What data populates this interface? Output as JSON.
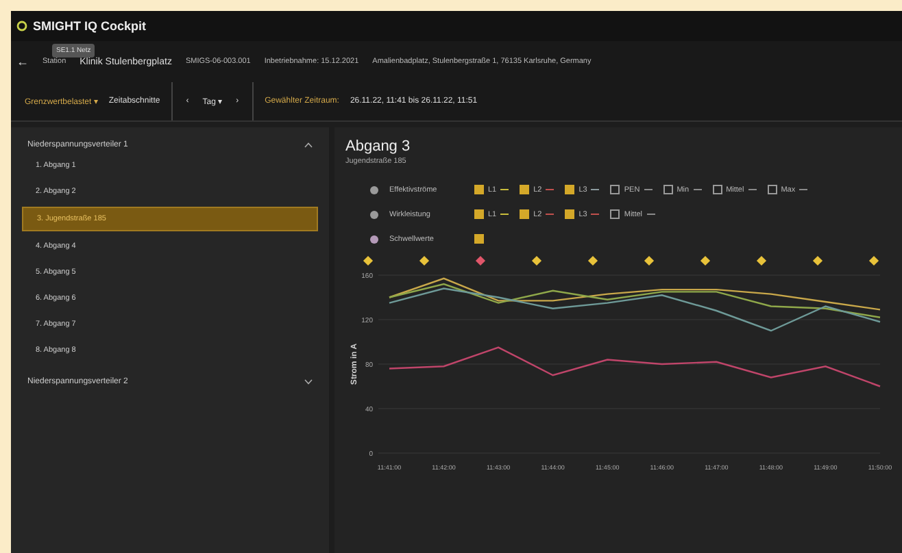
{
  "app": {
    "title": "SMIGHT IQ Cockpit"
  },
  "tooltip": "SE1.1 Netz",
  "info": {
    "back": "←",
    "label": "Station",
    "name": "Klinik Stulenbergplatz",
    "fields": [
      "SMIGS-06-003.001",
      "Inbetriebnahme: 15.12.2021",
      "Amalienbadplatz, Stulenbergstraße 1, 76135 Karlsruhe, Germany"
    ]
  },
  "toolbar": {
    "view": "Grenzwertbelastet",
    "view_caret": "▾",
    "mode": "Zeitabschnitte",
    "prev": "‹",
    "period": "Tag",
    "period_caret": "▾",
    "next": "›",
    "range_label": "Gewählter Zeitraum:",
    "range_value": "26.11.22, 11:41 bis 26.11.22, 11:51"
  },
  "sidebar": {
    "groups": [
      {
        "title": "Niederspannungsverteiler 1",
        "expanded": true,
        "items": [
          {
            "label": "1. Abgang 1",
            "selected": false
          },
          {
            "label": "2. Abgang 2",
            "selected": false
          },
          {
            "label": "3. Jugendstraße 185",
            "selected": true
          },
          {
            "label": "4. Abgang 4",
            "selected": false
          },
          {
            "label": "5. Abgang 5",
            "selected": false
          },
          {
            "label": "6. Abgang 6",
            "selected": false
          },
          {
            "label": "7. Abgang 7",
            "selected": false
          },
          {
            "label": "8. Abgang 8",
            "selected": false
          }
        ]
      },
      {
        "title": "Niederspannungsverteiler 2",
        "expanded": false
      }
    ]
  },
  "panel": {
    "title": "Abgang 3",
    "subtitle": "Jugendstraße 185",
    "filters": [
      {
        "label": "Effektivströme",
        "color": "#9a9a9a",
        "options": [
          {
            "label": "L1",
            "checked": true,
            "color": "#c9bd3c"
          },
          {
            "label": "L2",
            "checked": true,
            "color": "#c0504d"
          },
          {
            "label": "L3",
            "checked": true,
            "color": "#8c9a9e"
          },
          {
            "label": "PEN",
            "checked": false,
            "color": "#8a8a8a"
          },
          {
            "label": "Min",
            "checked": false,
            "color": "#8a8a8a"
          },
          {
            "label": "Mittel",
            "checked": false,
            "color": "#8a8a8a"
          },
          {
            "label": "Max",
            "checked": false,
            "color": "#8a8a8a"
          }
        ]
      },
      {
        "label": "Wirkleistung",
        "color": "#9a9a9a",
        "options": [
          {
            "label": "L1",
            "checked": true,
            "color": "#c9bd3c"
          },
          {
            "label": "L2",
            "checked": true,
            "color": "#c0504d"
          },
          {
            "label": "L3",
            "checked": true,
            "color": "#c0504d"
          },
          {
            "label": "Mittel",
            "checked": false,
            "color": "#8a8a8a"
          }
        ]
      },
      {
        "label": "Schwellwerte",
        "color": "#b49ab8",
        "options": [
          {
            "checked": true
          }
        ]
      }
    ],
    "events": [
      {
        "color": "#e8c23a"
      },
      {
        "color": "#e8c23a"
      },
      {
        "color": "#e0566a"
      },
      {
        "color": "#e8c23a"
      },
      {
        "color": "#e8c23a"
      },
      {
        "color": "#e8c23a"
      },
      {
        "color": "#e8c23a"
      },
      {
        "color": "#e8c23a"
      },
      {
        "color": "#e8c23a"
      },
      {
        "color": "#e8c23a"
      }
    ],
    "chart_data": {
      "type": "line",
      "ylabel": "Strom in A",
      "categories": [
        "11:41:00",
        "11:42:00",
        "11:43:00",
        "11:44:00",
        "11:45:00",
        "11:46:00",
        "11:47:00",
        "11:48:00",
        "11:49:00",
        "11:50:00"
      ],
      "series": [
        {
          "color": "#c9a84a",
          "values": [
            140,
            157,
            137,
            137,
            143,
            147,
            147,
            143,
            136,
            129
          ]
        },
        {
          "color": "#8fa84a",
          "values": [
            140,
            152,
            135,
            146,
            138,
            145,
            145,
            132,
            130,
            122
          ]
        },
        {
          "color": "#6e9a98",
          "values": [
            135,
            148,
            140,
            130,
            135,
            142,
            128,
            110,
            132,
            118
          ]
        },
        {
          "color": "#c0456a",
          "values": [
            76,
            78,
            95,
            70,
            84,
            80,
            82,
            68,
            78,
            60
          ]
        }
      ],
      "grid": true,
      "ylim": [
        0,
        160
      ],
      "yticks": [
        0,
        40,
        80,
        120,
        160
      ]
    }
  }
}
